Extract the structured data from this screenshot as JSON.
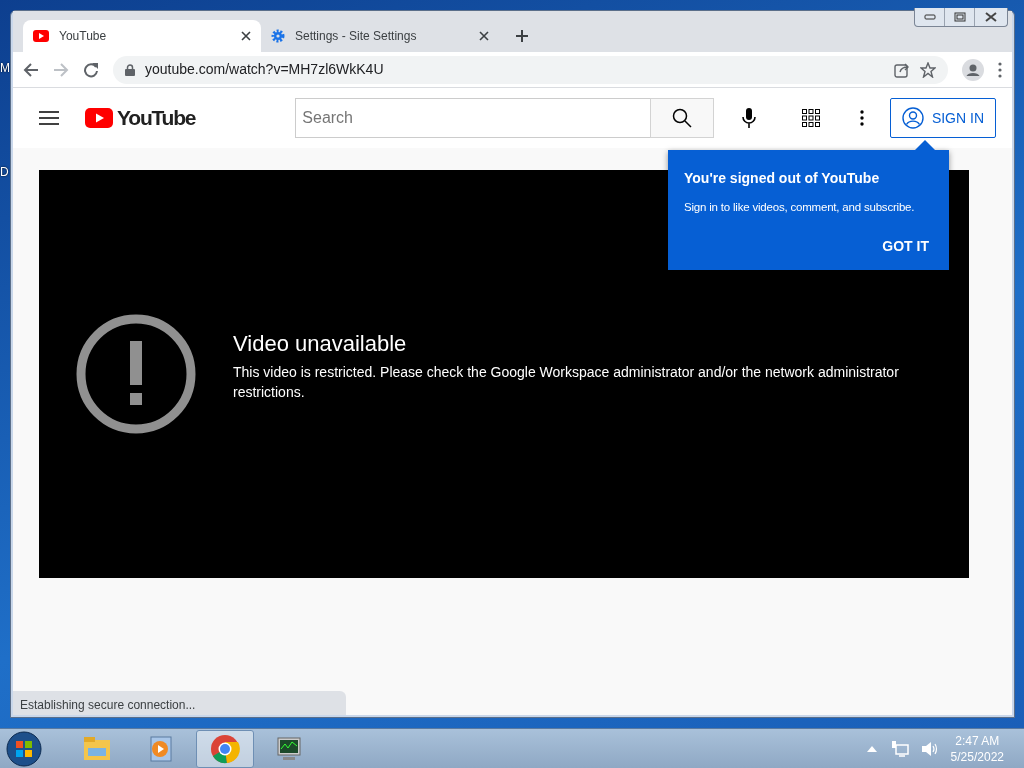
{
  "desktop_labels": [
    "M",
    "D"
  ],
  "browser": {
    "tabs": [
      {
        "title": "YouTube",
        "kind": "youtube",
        "selected": true
      },
      {
        "title": "Settings - Site Settings",
        "kind": "settings",
        "selected": false
      }
    ],
    "address": "youtube.com/watch?v=MH7zl6WkK4U",
    "status": "Establishing secure connection..."
  },
  "youtube": {
    "logo_text": "YouTube",
    "search": {
      "placeholder": "Search"
    },
    "sign_in": "SIGN IN",
    "player": {
      "title": "Video unavailable",
      "message": "This video is restricted. Please check the Google Workspace administrator and/or the network administrator restrictions."
    },
    "popup": {
      "title": "You're signed out of YouTube",
      "body": "Sign in to like videos, comment, and subscribe.",
      "button": "GOT IT"
    }
  },
  "taskbar": {
    "items": [
      {
        "kind": "explorer",
        "selected": false
      },
      {
        "kind": "media",
        "selected": false
      },
      {
        "kind": "chrome",
        "selected": true
      },
      {
        "kind": "monitor",
        "selected": false
      }
    ],
    "time": "2:47 AM",
    "date": "5/25/2022"
  }
}
